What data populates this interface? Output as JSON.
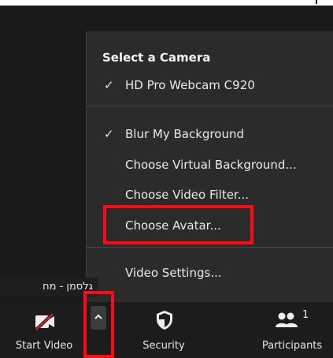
{
  "menu": {
    "heading": "Select a Camera",
    "camera": {
      "check": "✓",
      "label": "HD Pro Webcam C920"
    },
    "blur": {
      "check": "✓",
      "label": "Blur My Background"
    },
    "virtual_bg": "Choose Virtual Background...",
    "video_filter": "Choose Video Filter...",
    "avatar": "Choose Avatar...",
    "video_settings": "Video Settings..."
  },
  "participant_name_tag": "גלסמן - מח",
  "toolbar": {
    "start_video": "Start Video",
    "security": "Security",
    "participants": "Participants",
    "participants_count": "1"
  },
  "colors": {
    "highlight": "#ff0a12",
    "menu_bg": "#2b2b2b",
    "toolbar_bg": "#1c1c1c"
  },
  "icons": {
    "video": "video-off-icon",
    "chevron": "chevron-up-icon",
    "security": "shield-icon",
    "participants": "people-icon"
  }
}
